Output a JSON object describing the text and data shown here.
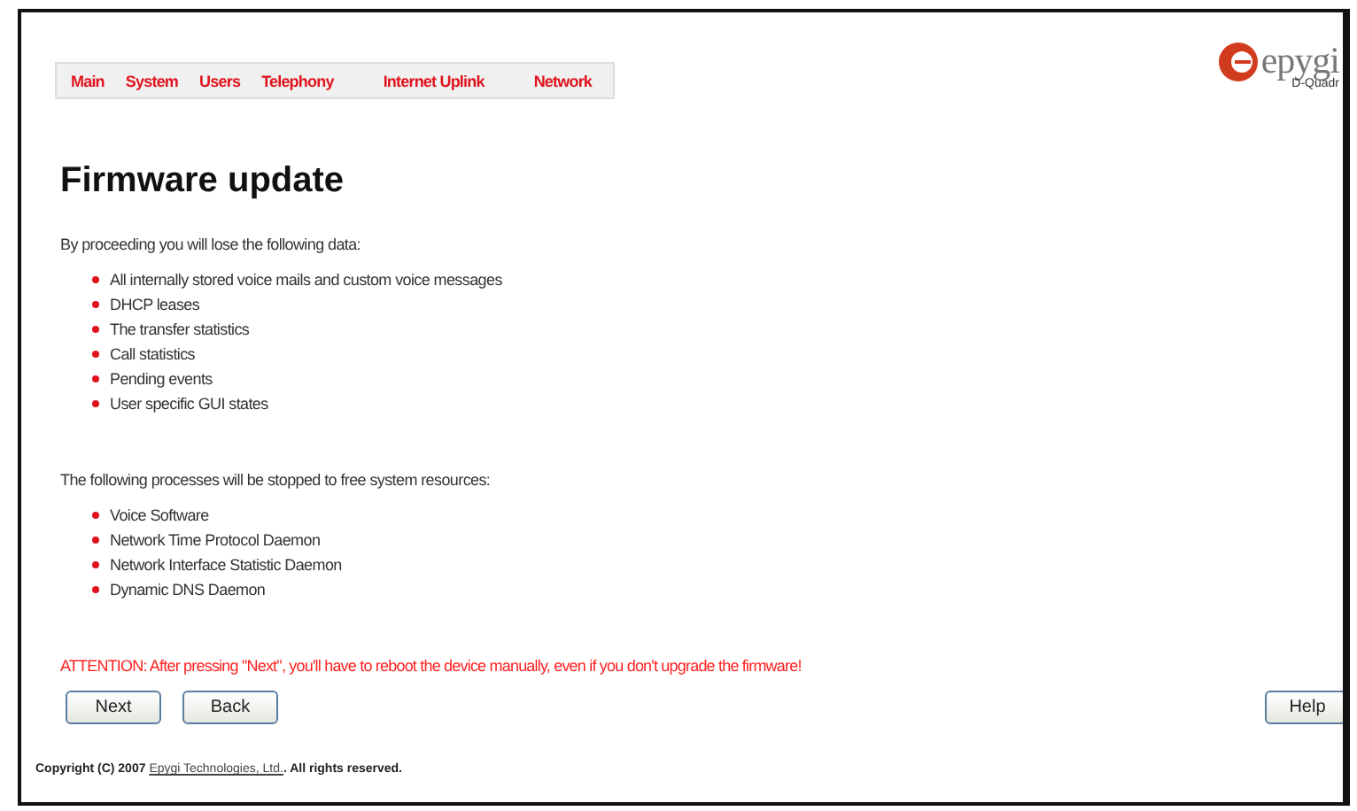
{
  "nav": [
    {
      "label": "Main",
      "selected": false
    },
    {
      "label": "System",
      "selected": false
    },
    {
      "label": "Users",
      "selected": false
    },
    {
      "label": "Telephony",
      "selected": false
    },
    {
      "label": "Internet Uplink",
      "selected": false
    },
    {
      "label": "Network",
      "selected": false
    }
  ],
  "logo": {
    "name": "epygi",
    "model": "D-Quadr"
  },
  "title": "Firmware update",
  "sections": [
    {
      "intro": "By proceeding you will lose the following data:",
      "items": [
        "All internally stored voice mails and custom voice messages",
        "DHCP leases",
        "The transfer statistics",
        "Call statistics",
        "Pending events",
        "User specific GUI states"
      ]
    },
    {
      "intro": "The following processes will be stopped to free system resources:",
      "items": [
        "Voice Software",
        "Network Time Protocol Daemon",
        "Network Interface Statistic Daemon",
        "Dynamic DNS Daemon"
      ]
    }
  ],
  "attention": "ATTENTION: After pressing \"Next\", you'll have to reboot the device manually, even if you don't upgrade the firmware!",
  "buttons": [
    {
      "label": "Next",
      "kind": "left"
    },
    {
      "label": "Back",
      "kind": "left"
    },
    {
      "label": "Help",
      "kind": "right"
    }
  ],
  "footer": {
    "before": "Copyright (C) 2007 ",
    "link": "Epygi Technologies, Ltd.",
    "after": ". All rights reserved."
  }
}
